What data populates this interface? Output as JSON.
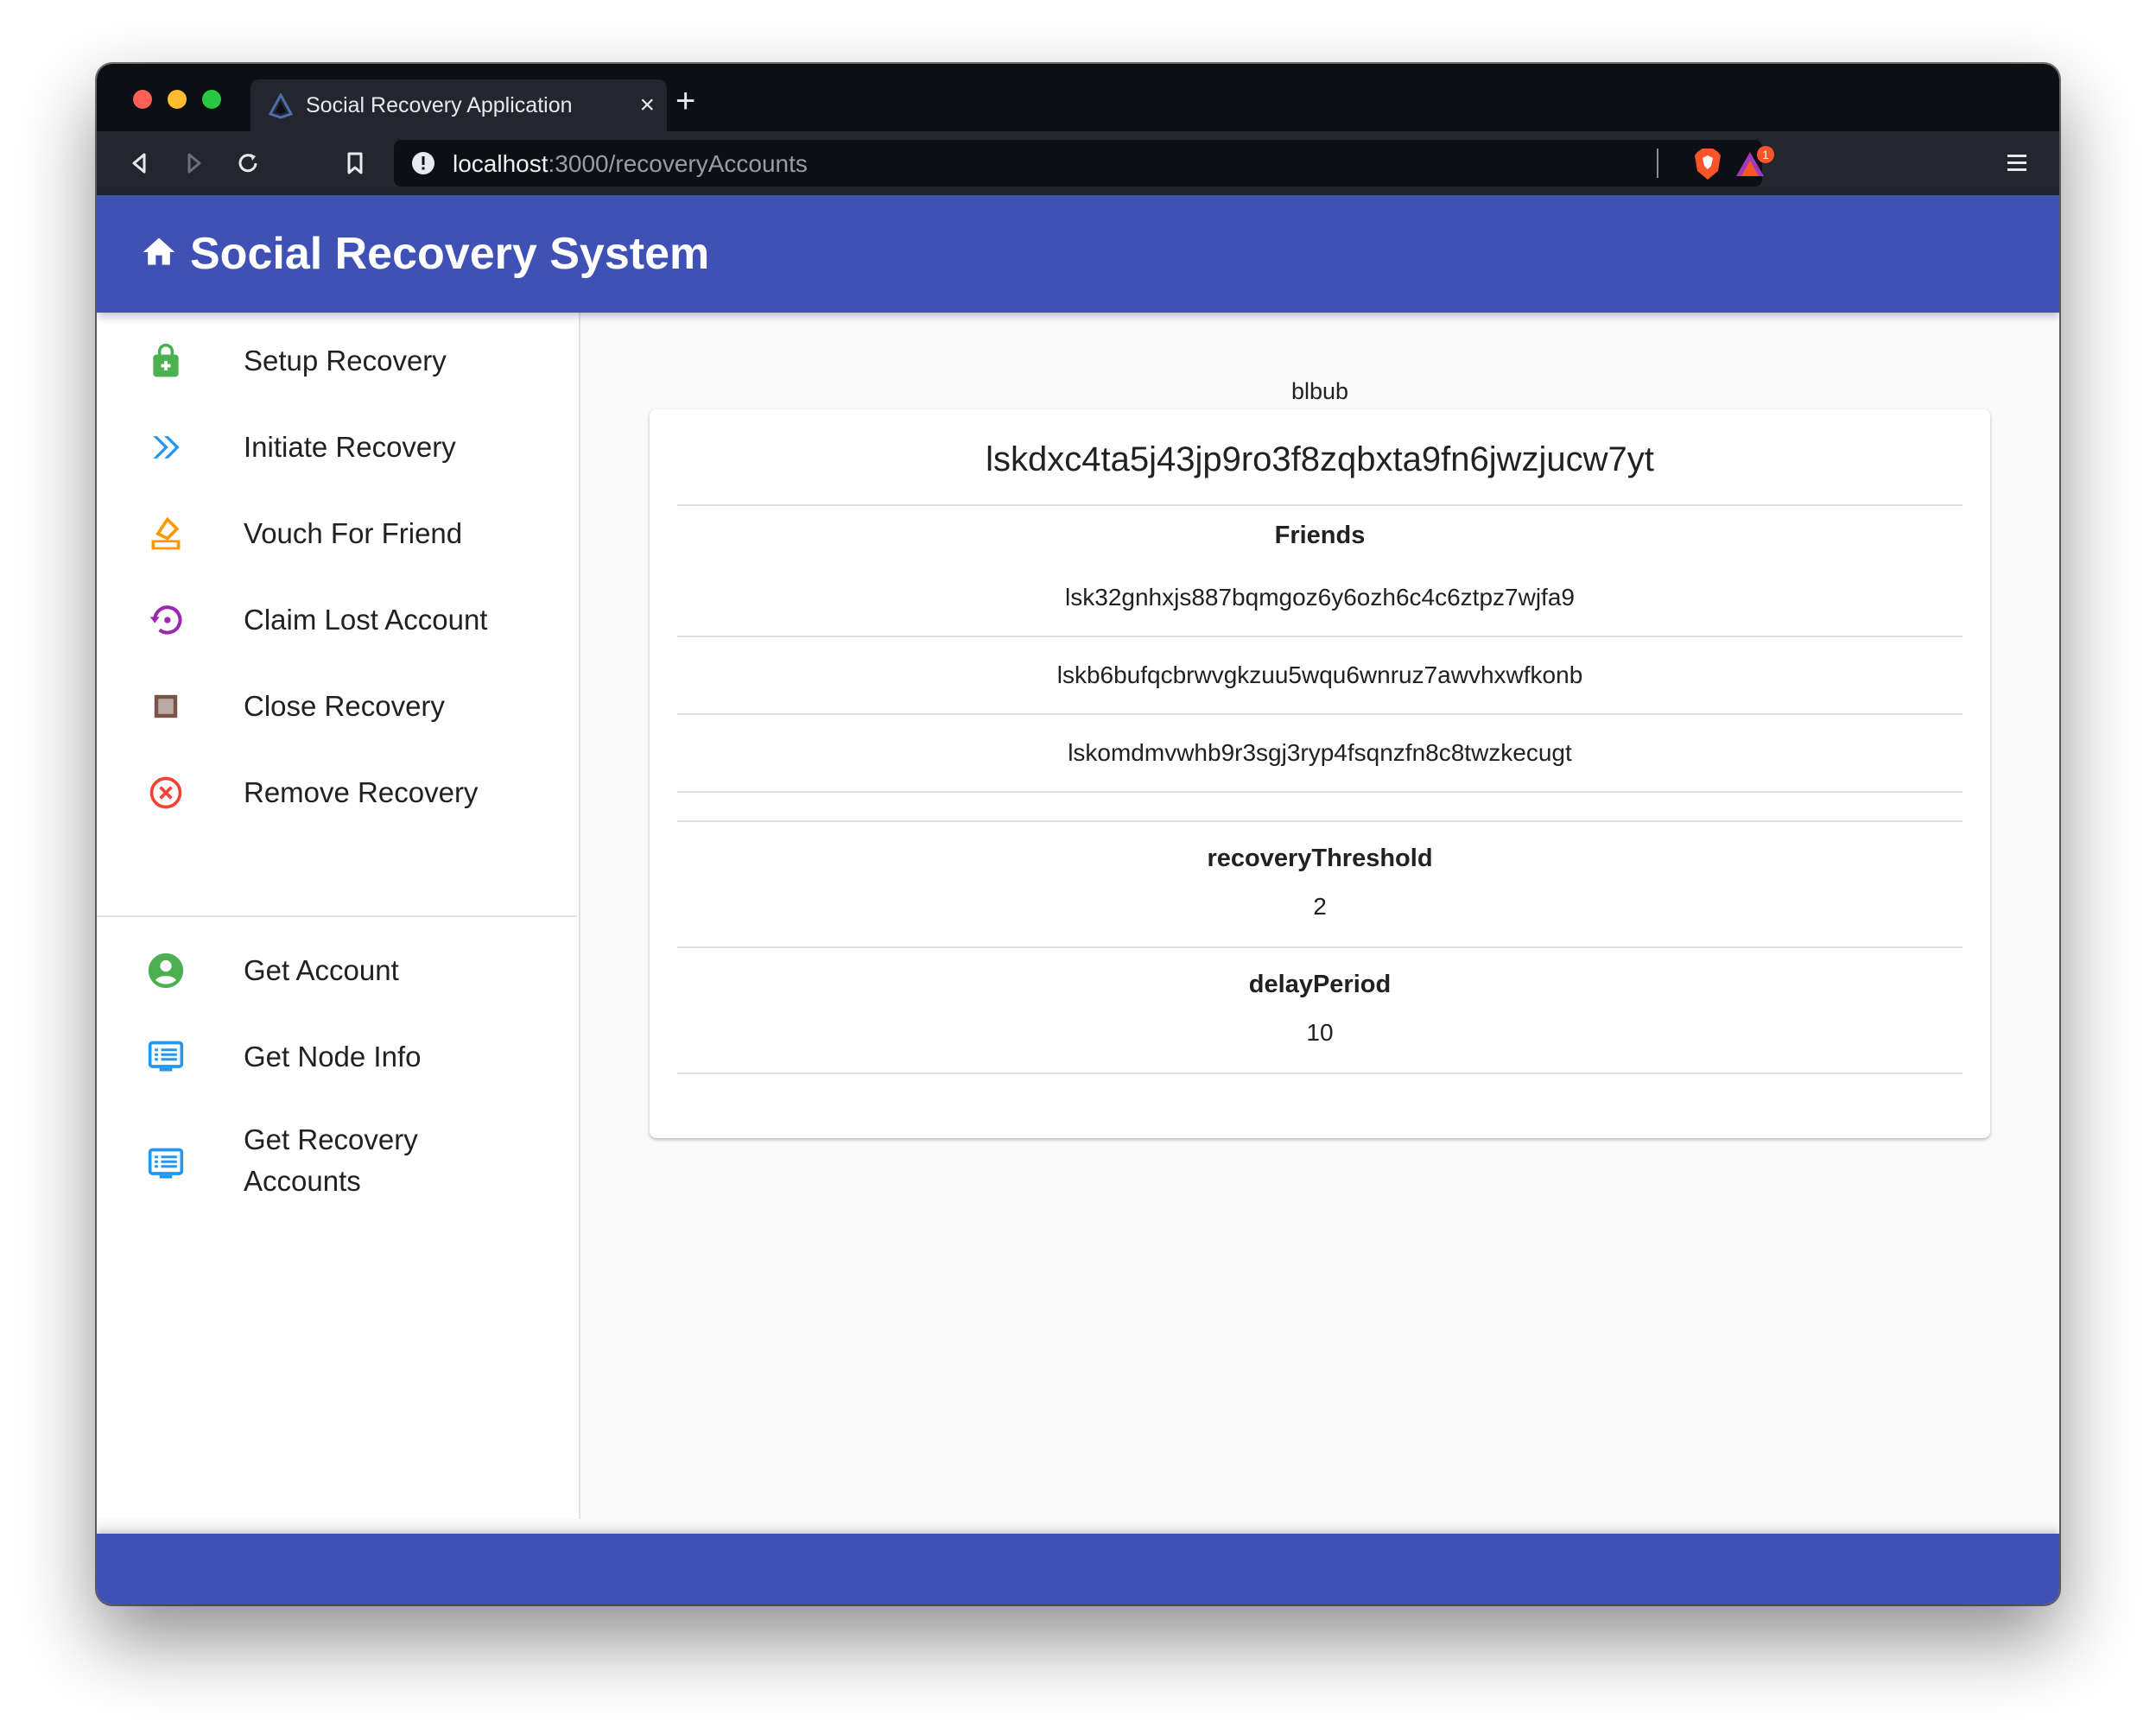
{
  "browser": {
    "tab_title": "Social Recovery Application",
    "tab_close": "×",
    "new_tab": "+",
    "url_host": "localhost",
    "url_path": ":3000/recoveryAccounts",
    "rewards_badge": "1"
  },
  "app": {
    "title": "Social Recovery System",
    "brand_color": "#3f51b5"
  },
  "sidebar": {
    "primary_items": [
      {
        "label": "Setup Recovery",
        "icon": "lock-icon",
        "color": "#4caf50"
      },
      {
        "label": "Initiate Recovery",
        "icon": "double-chevron-right-icon",
        "color": "#2196f3"
      },
      {
        "label": "Vouch For Friend",
        "icon": "ballot-box-icon",
        "color": "#ff9800"
      },
      {
        "label": "Claim Lost Account",
        "icon": "restore-icon",
        "color": "#9c27b0"
      },
      {
        "label": "Close Recovery",
        "icon": "stop-square-icon",
        "color": "#795548"
      },
      {
        "label": "Remove Recovery",
        "icon": "cancel-circle-icon",
        "color": "#f44336"
      }
    ],
    "secondary_items": [
      {
        "label": "Get Account",
        "icon": "account-circle-icon",
        "color": "#4caf50"
      },
      {
        "label": "Get Node Info",
        "icon": "monitor-list-icon",
        "color": "#2196f3"
      },
      {
        "label": "Get Recovery Accounts",
        "icon": "monitor-list-icon",
        "color": "#2196f3"
      }
    ]
  },
  "main": {
    "caption": "blbub",
    "account_address": "lskdxc4ta5j43jp9ro3f8zqbxta9fn6jwzjucw7yt",
    "friends_heading": "Friends",
    "friends": [
      "lsk32gnhxjs887bqmgoz6y6ozh6c4c6ztpz7wjfa9",
      "lskb6bufqcbrwvgkzuu5wqu6wnruz7awvhxwfkonb",
      "lskomdmvwhb9r3sgj3ryp4fsqnzfn8c8twzkecugt"
    ],
    "threshold_heading": "recoveryThreshold",
    "threshold_value": "2",
    "delay_heading": "delayPeriod",
    "delay_value": "10"
  }
}
